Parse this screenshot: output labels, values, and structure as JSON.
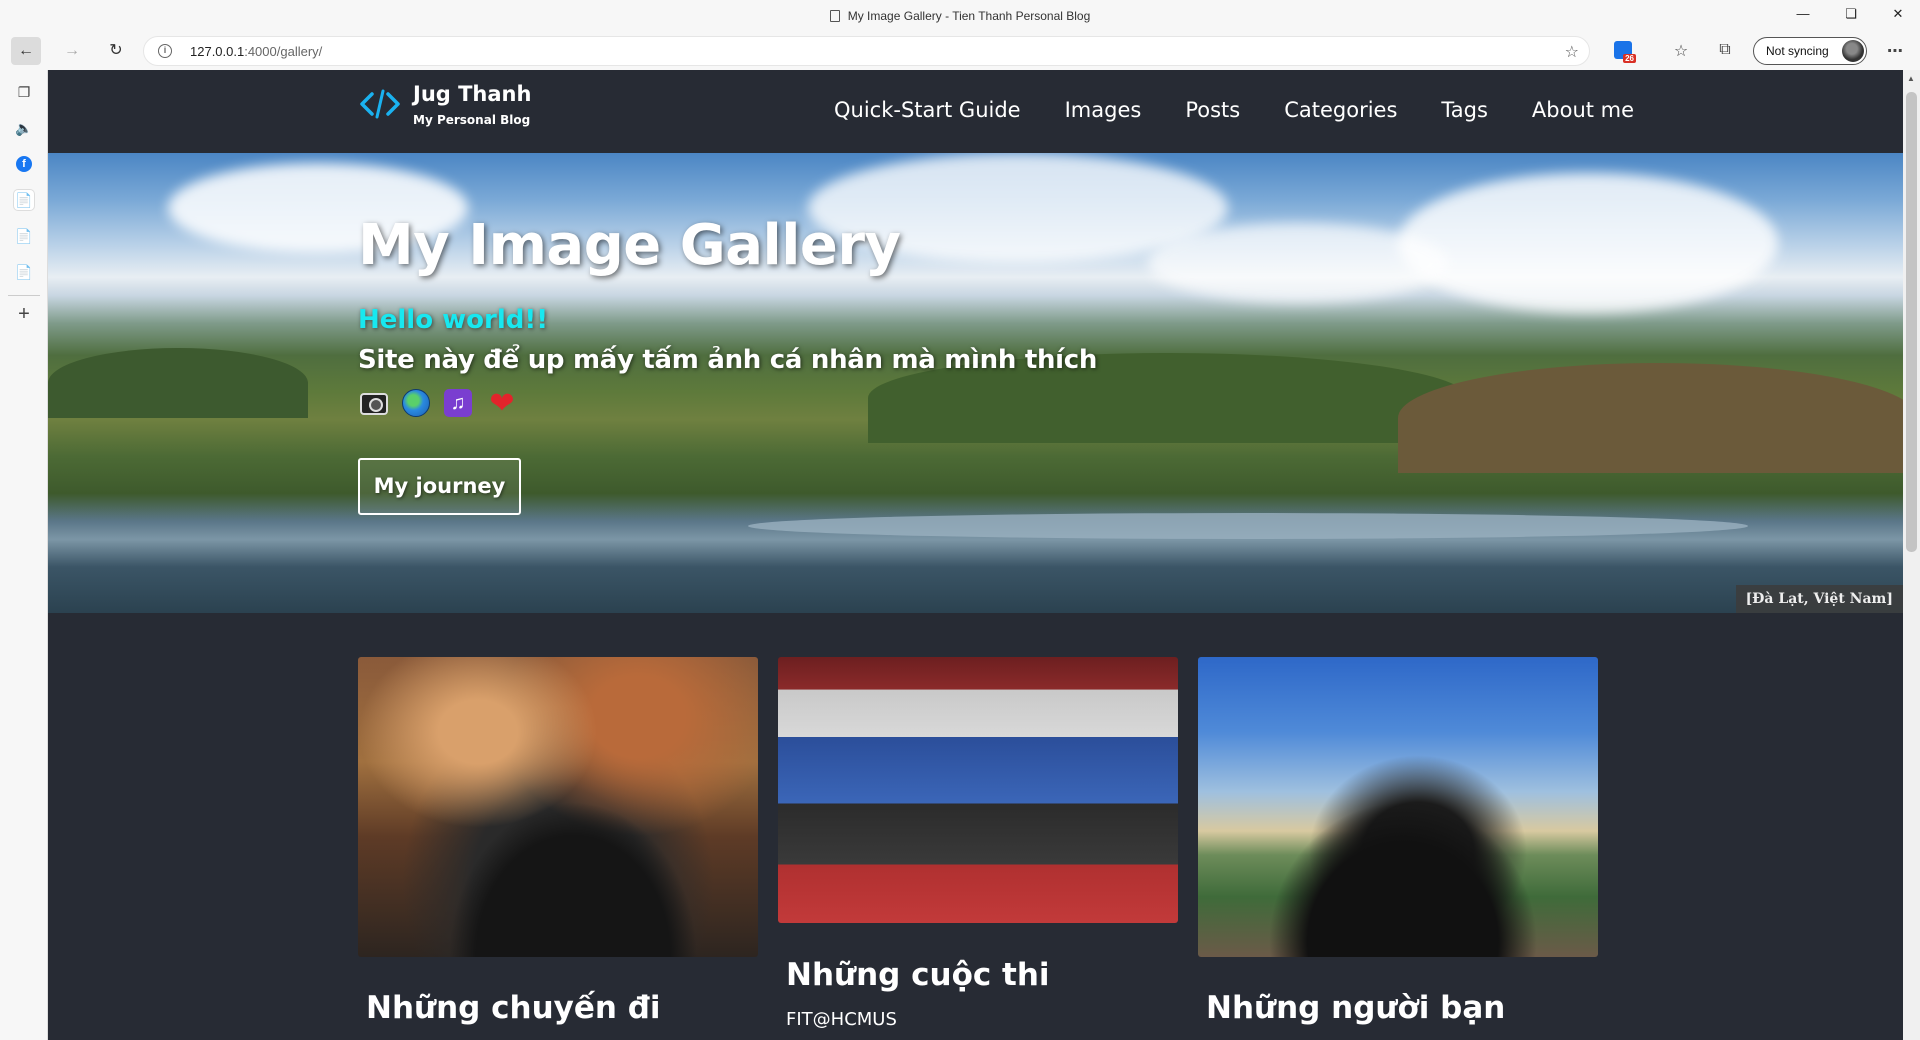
{
  "browser": {
    "tab_title": "My Image Gallery - Tien Thanh Personal Blog",
    "url_host": "127.0.0.1",
    "url_path": ":4000/gallery/",
    "sync_label": "Not syncing",
    "extension_badge": "26"
  },
  "site": {
    "brand_title": "Jug Thanh",
    "brand_subtitle": "My Personal Blog",
    "nav": [
      {
        "label": "Quick-Start Guide"
      },
      {
        "label": "Images"
      },
      {
        "label": "Posts"
      },
      {
        "label": "Categories"
      },
      {
        "label": "Tags"
      },
      {
        "label": "About me"
      }
    ]
  },
  "hero": {
    "title": "My Image Gallery",
    "hello": "Hello world!!",
    "description": "Site này để up mấy tấm ảnh cá nhân mà mình thích",
    "icons": [
      "camera-icon",
      "globe-icon",
      "music-icon",
      "heart-icon"
    ],
    "button_label": "My journey",
    "caption": "[Đà Lạt, Việt Nam]"
  },
  "gallery": [
    {
      "title": "Những chuyến đi",
      "subtitle": ""
    },
    {
      "title": "Những cuộc thi",
      "subtitle": "FIT@HCMUS"
    },
    {
      "title": "Những người bạn",
      "subtitle": ""
    }
  ],
  "colors": {
    "page_bg": "#272b34",
    "accent_cyan": "#18e8f0",
    "brand_icon": "#1ab2f0"
  }
}
